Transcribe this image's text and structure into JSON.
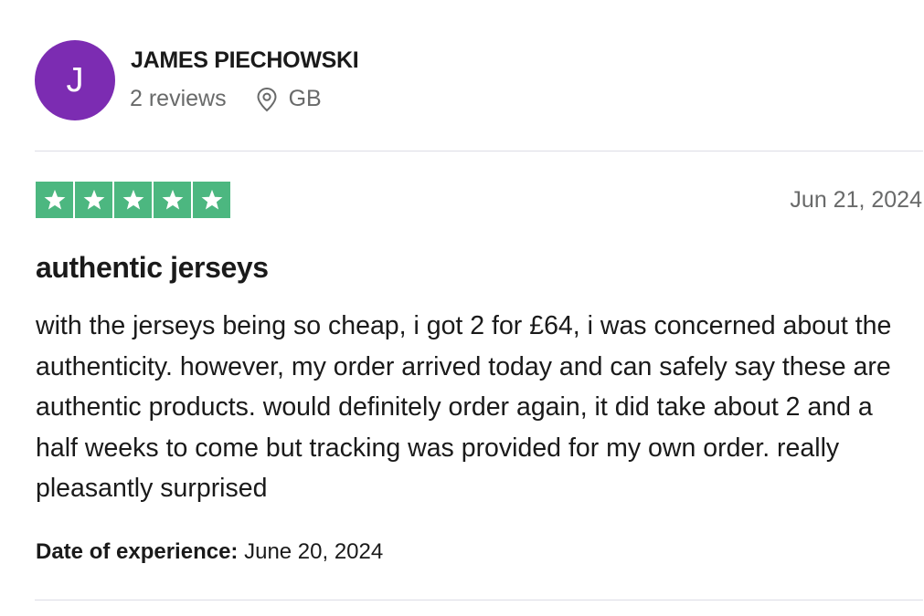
{
  "reviewer": {
    "initial": "J",
    "name": "JAMES PIECHOWSKI",
    "reviews_count": "2 reviews",
    "country": "GB",
    "avatar_color": "#7c2cb2"
  },
  "review": {
    "rating": 5,
    "rating_max": 5,
    "star_color": "#4cb780",
    "date": "Jun 21, 2024",
    "title": "authentic jerseys",
    "body": "with the jerseys being so cheap, i got 2 for £64, i was concerned about the authenticity. however, my order arrived today and can safely say these are authentic products. would definitely order again, it did take about 2 and a half weeks to come but tracking was provided for my own order. really pleasantly surprised",
    "experience_label": "Date of experience:",
    "experience_date": "June 20, 2024"
  }
}
